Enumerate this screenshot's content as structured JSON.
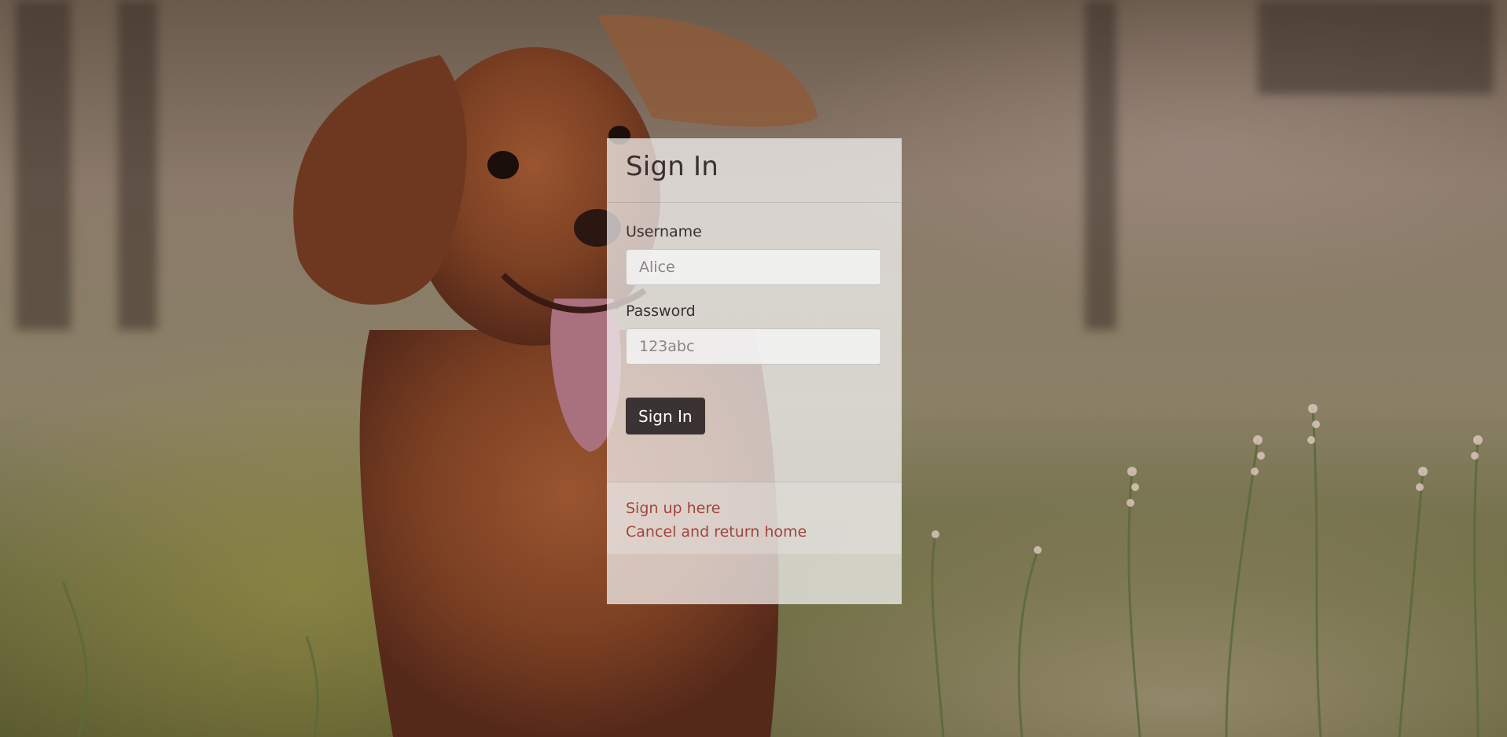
{
  "signin_panel": {
    "title": "Sign In",
    "username": {
      "label": "Username",
      "placeholder": "Alice"
    },
    "password": {
      "label": "Password",
      "placeholder": "123abc"
    },
    "submit_label": "Sign In",
    "links": {
      "signup": "Sign up here",
      "cancel": "Cancel and return home"
    }
  },
  "colors": {
    "button_bg": "#3b3333",
    "link": "#a0453d",
    "panel_bg": "#f5f5f5"
  }
}
